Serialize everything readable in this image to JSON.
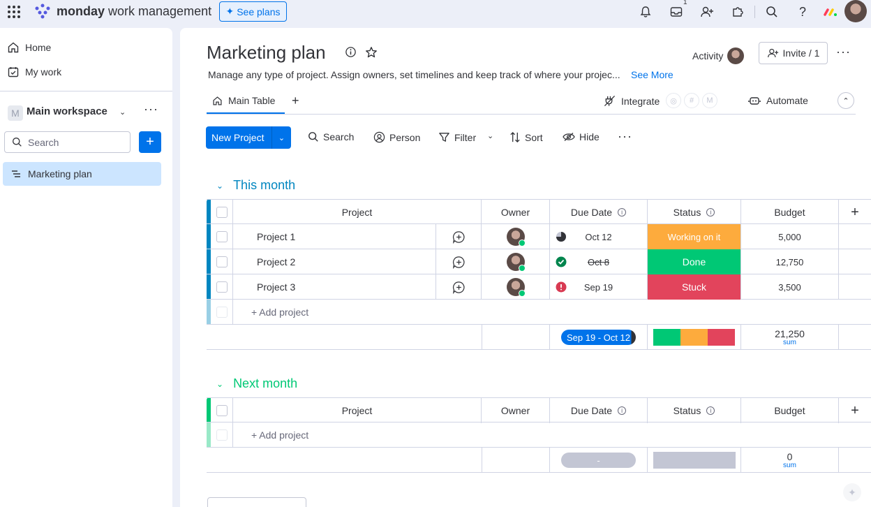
{
  "topbar": {
    "brand_bold": "monday",
    "brand_light": " work management",
    "see_plans_label": "See plans",
    "notification_count": "1"
  },
  "sidebar": {
    "home_label": "Home",
    "my_work_label": "My work",
    "workspace_name": "Main workspace",
    "workspace_initial": "M",
    "search_placeholder": "Search",
    "board_label": "Marketing plan"
  },
  "board": {
    "title": "Marketing plan",
    "description": "Manage any type of project. Assign owners, set timelines and keep track of where your projec...",
    "see_more": "See More",
    "activity_label": "Activity",
    "invite_label": "Invite / 1",
    "tab_main": "Main Table",
    "integrate_label": "Integrate",
    "automate_label": "Automate"
  },
  "toolbar": {
    "new_project": "New Project",
    "search": "Search",
    "person": "Person",
    "filter": "Filter",
    "sort": "Sort",
    "hide": "Hide"
  },
  "columns": {
    "project": "Project",
    "owner": "Owner",
    "due_date": "Due Date",
    "status": "Status",
    "budget": "Budget"
  },
  "groups": [
    {
      "name": "This month",
      "color": "#0086c0",
      "rows": [
        {
          "name": "Project 1",
          "date": "Oct 12",
          "date_icon": "half-clock",
          "status": "Working on it",
          "status_color": "#fdab3d",
          "budget": "5,000"
        },
        {
          "name": "Project 2",
          "date": "Oct 8",
          "date_icon": "check-circle",
          "status": "Done",
          "status_color": "#00c875",
          "budget": "12,750"
        },
        {
          "name": "Project 3",
          "date": "Sep 19",
          "date_icon": "alert-circle",
          "status": "Stuck",
          "status_color": "#e2445c",
          "budget": "3,500"
        }
      ],
      "add_label": "+ Add project",
      "summary_dates": "Sep 19 - Oct 12",
      "summary_budget": "21,250",
      "summary_label": "sum"
    },
    {
      "name": "Next month",
      "color": "#00c875",
      "rows": [],
      "add_label": "+ Add project",
      "summary_dates": "-",
      "summary_budget": "0",
      "summary_label": "sum"
    }
  ]
}
